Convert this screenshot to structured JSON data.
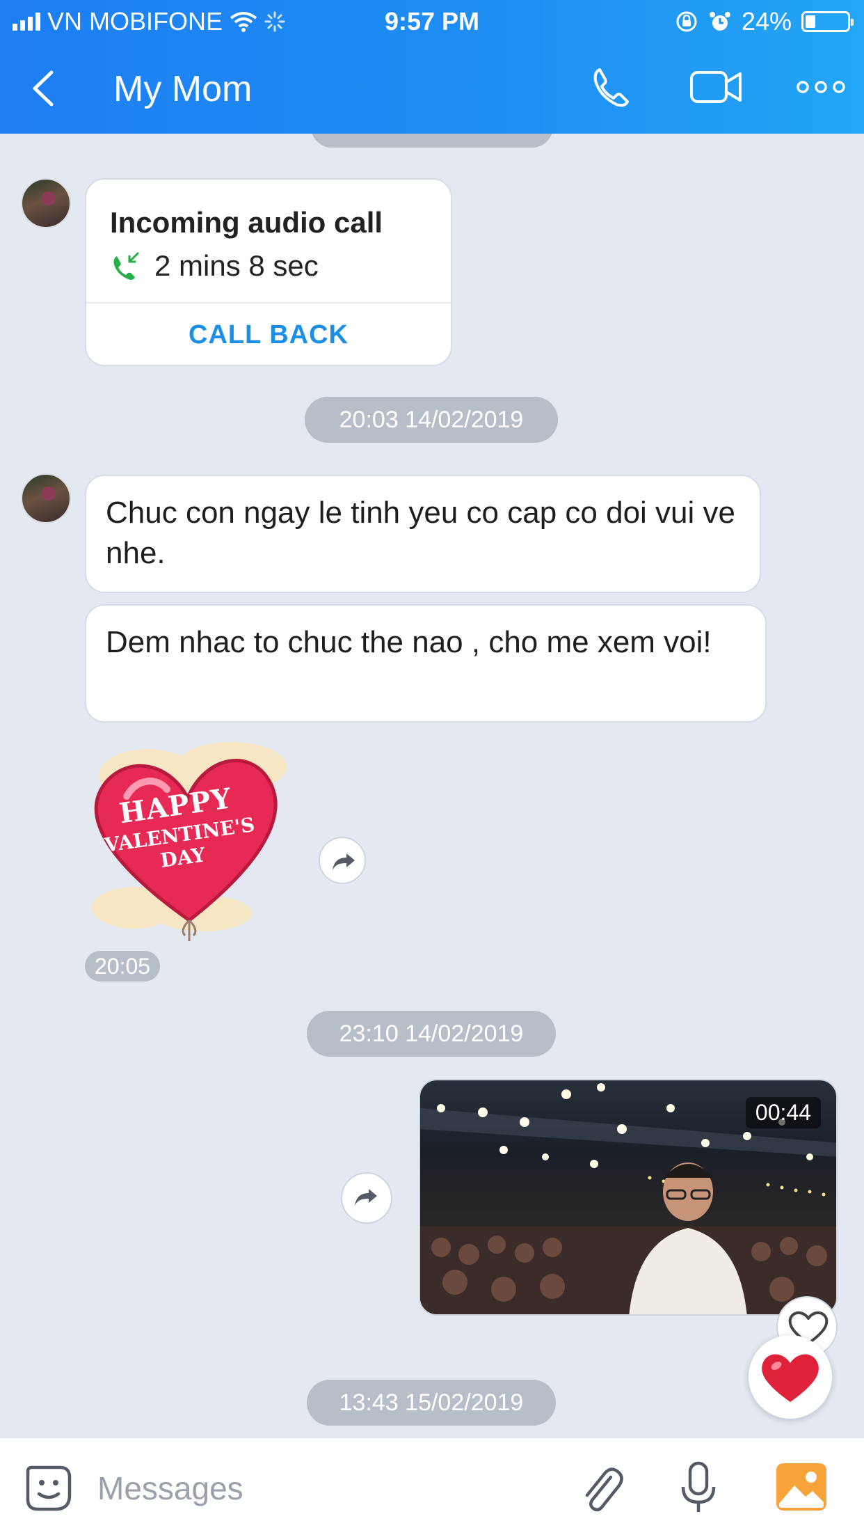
{
  "status_bar": {
    "carrier": "VN MOBIFONE",
    "time": "9:57 PM",
    "battery": "24%"
  },
  "header": {
    "title": "My Mom",
    "icons": [
      "back-icon",
      "phone-icon",
      "video-call-icon",
      "more-icon"
    ]
  },
  "messages": {
    "call_card": {
      "title": "Incoming audio call",
      "duration": "2 mins 8 sec",
      "action": "CALL BACK"
    },
    "date_1": "20:03 14/02/2019",
    "text_1": "Chuc con ngay le tinh yeu co cap co doi vui ve nhe.",
    "text_2": "Dem nhac to chuc the nao , cho me xem voi!",
    "sticker": {
      "line1": "HAPPY",
      "line2": "VALENTINE'S DAY"
    },
    "sticker_time": "20:05",
    "date_2": "23:10 14/02/2019",
    "video_duration": "00:44",
    "date_3": "13:43 15/02/2019"
  },
  "composer": {
    "placeholder": "Messages"
  },
  "colors": {
    "header_start": "#1d7ef2",
    "header_end": "#22a6f5",
    "chat_bg": "#e4e8f1",
    "accent": "#1b8ee6",
    "call_green": "#27b04a",
    "heart_red": "#e0213a"
  }
}
